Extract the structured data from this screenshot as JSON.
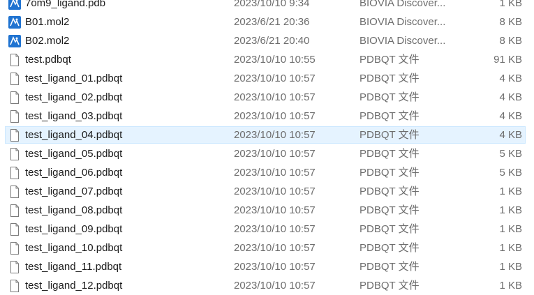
{
  "files": [
    {
      "name": "7om9_ligand.pdb",
      "date": "2023/10/10 9:34",
      "type": "BIOVIA Discover...",
      "size": "1 KB",
      "icon": "biovia-app-icon",
      "selected": false
    },
    {
      "name": "B01.mol2",
      "date": "2023/6/21 20:36",
      "type": "BIOVIA Discover...",
      "size": "8 KB",
      "icon": "biovia-app-icon",
      "selected": false
    },
    {
      "name": "B02.mol2",
      "date": "2023/6/21 20:40",
      "type": "BIOVIA Discover...",
      "size": "8 KB",
      "icon": "biovia-app-icon",
      "selected": false
    },
    {
      "name": "test.pdbqt",
      "date": "2023/10/10 10:55",
      "type": "PDBQT 文件",
      "size": "91 KB",
      "icon": "document-icon",
      "selected": false
    },
    {
      "name": "test_ligand_01.pdbqt",
      "date": "2023/10/10 10:57",
      "type": "PDBQT 文件",
      "size": "4 KB",
      "icon": "document-icon",
      "selected": false
    },
    {
      "name": "test_ligand_02.pdbqt",
      "date": "2023/10/10 10:57",
      "type": "PDBQT 文件",
      "size": "4 KB",
      "icon": "document-icon",
      "selected": false
    },
    {
      "name": "test_ligand_03.pdbqt",
      "date": "2023/10/10 10:57",
      "type": "PDBQT 文件",
      "size": "4 KB",
      "icon": "document-icon",
      "selected": false
    },
    {
      "name": "test_ligand_04.pdbqt",
      "date": "2023/10/10 10:57",
      "type": "PDBQT 文件",
      "size": "4 KB",
      "icon": "document-icon",
      "selected": true
    },
    {
      "name": "test_ligand_05.pdbqt",
      "date": "2023/10/10 10:57",
      "type": "PDBQT 文件",
      "size": "5 KB",
      "icon": "document-icon",
      "selected": false
    },
    {
      "name": "test_ligand_06.pdbqt",
      "date": "2023/10/10 10:57",
      "type": "PDBQT 文件",
      "size": "5 KB",
      "icon": "document-icon",
      "selected": false
    },
    {
      "name": "test_ligand_07.pdbqt",
      "date": "2023/10/10 10:57",
      "type": "PDBQT 文件",
      "size": "1 KB",
      "icon": "document-icon",
      "selected": false
    },
    {
      "name": "test_ligand_08.pdbqt",
      "date": "2023/10/10 10:57",
      "type": "PDBQT 文件",
      "size": "1 KB",
      "icon": "document-icon",
      "selected": false
    },
    {
      "name": "test_ligand_09.pdbqt",
      "date": "2023/10/10 10:57",
      "type": "PDBQT 文件",
      "size": "1 KB",
      "icon": "document-icon",
      "selected": false
    },
    {
      "name": "test_ligand_10.pdbqt",
      "date": "2023/10/10 10:57",
      "type": "PDBQT 文件",
      "size": "1 KB",
      "icon": "document-icon",
      "selected": false
    },
    {
      "name": "test_ligand_11.pdbqt",
      "date": "2023/10/10 10:57",
      "type": "PDBQT 文件",
      "size": "1 KB",
      "icon": "document-icon",
      "selected": false
    },
    {
      "name": "test_ligand_12.pdbqt",
      "date": "2023/10/10 10:57",
      "type": "PDBQT 文件",
      "size": "1 KB",
      "icon": "document-icon",
      "selected": false
    }
  ],
  "colors": {
    "selection_fill": "#e5f3ff",
    "selection_border": "#cce8ff",
    "biovia_blue": "#1f73d1",
    "secondary_text": "#6d6d6d"
  }
}
